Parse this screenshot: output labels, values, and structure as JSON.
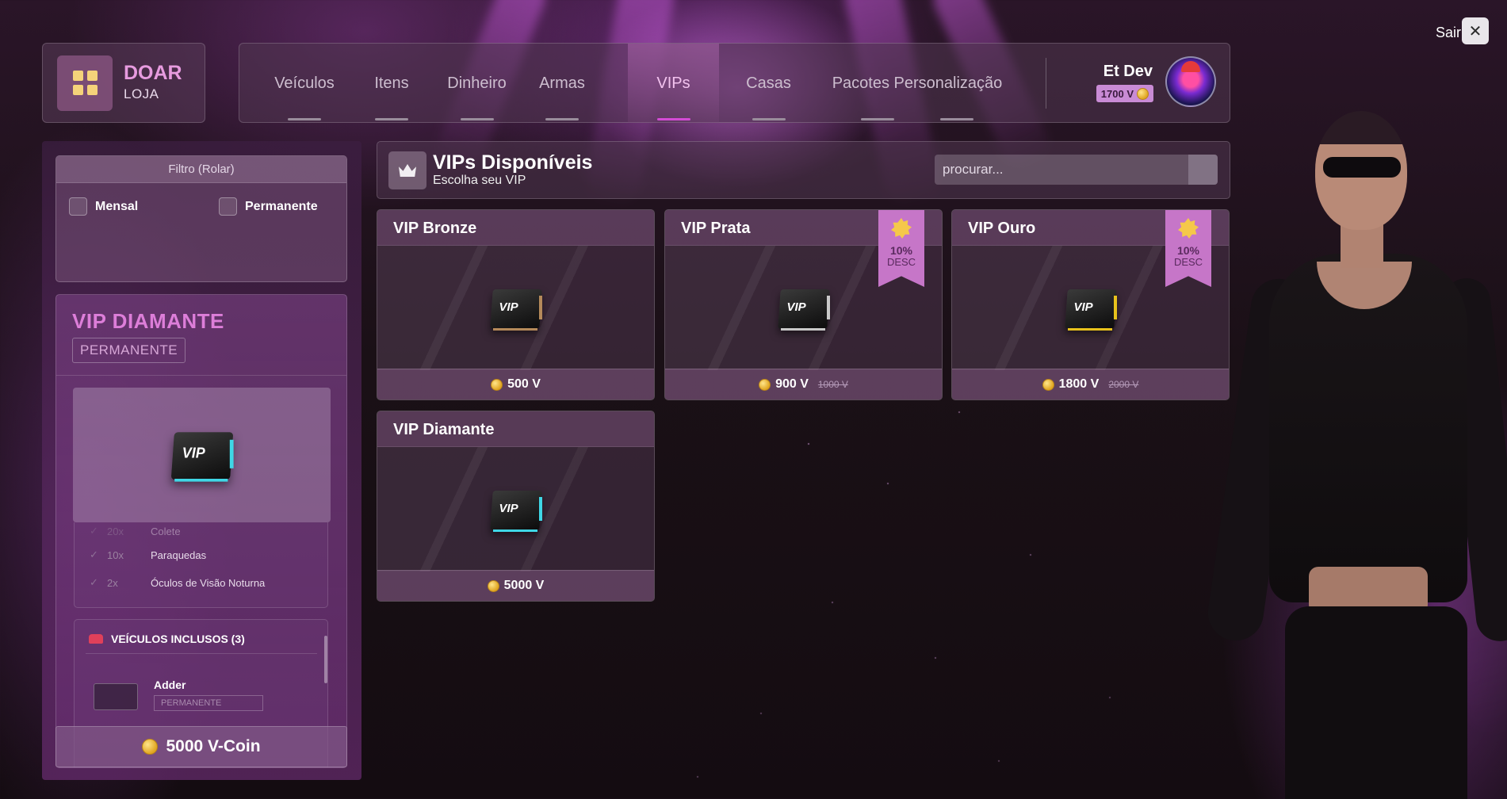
{
  "logo": {
    "title": "DOAR",
    "subtitle": "LOJA"
  },
  "nav": {
    "tabs": [
      {
        "label": "Veículos"
      },
      {
        "label": "Itens"
      },
      {
        "label": "Dinheiro"
      },
      {
        "label": "Armas"
      },
      {
        "label": "VIPs",
        "active": true
      },
      {
        "label": "Casas"
      },
      {
        "label": "Pacotes Personalização"
      }
    ]
  },
  "user": {
    "name": "Et Dev",
    "balance": "1700 V"
  },
  "exit": {
    "label": "Sair",
    "close_symbol": "✕"
  },
  "filter": {
    "title": "Filtro (Rolar)",
    "options": [
      {
        "label": "Mensal",
        "checked": false
      },
      {
        "label": "Permanente",
        "checked": false
      }
    ]
  },
  "detail": {
    "title": "VIP DIAMANTE",
    "badge": "PERMANENTE",
    "items": [
      {
        "qty": "20x",
        "name": "Colete"
      },
      {
        "qty": "10x",
        "name": "Paraquedas"
      },
      {
        "qty": "2x",
        "name": "Óculos de Visão Noturna"
      }
    ],
    "vehicles_title": "VEÍCULOS INCLUSOS (3)",
    "vehicle": {
      "name": "Adder",
      "type": "PERMANENTE"
    },
    "price": "5000 V-Coin"
  },
  "main": {
    "title": "VIPs Disponíveis",
    "subtitle": "Escolha seu VIP",
    "search_placeholder": "procurar..."
  },
  "cards": [
    {
      "title": "VIP Bronze",
      "price": "500 V",
      "old_price": "",
      "discount": "",
      "accent": "#b58a5a"
    },
    {
      "title": "VIP Prata",
      "price": "900 V",
      "old_price": "1000 V",
      "discount": "10%",
      "discount_label": "DESC",
      "accent": "#c9c9c9"
    },
    {
      "title": "VIP Ouro",
      "price": "1800 V",
      "old_price": "2000 V",
      "discount": "10%",
      "discount_label": "DESC",
      "accent": "#e8c21c"
    },
    {
      "title": "VIP Diamante",
      "price": "5000 V",
      "old_price": "",
      "discount": "",
      "accent": "#3fd7e6"
    }
  ],
  "colors": {
    "accent": "#d44bd6",
    "brand": "#e79bdf",
    "coin": "#f2b72b"
  }
}
